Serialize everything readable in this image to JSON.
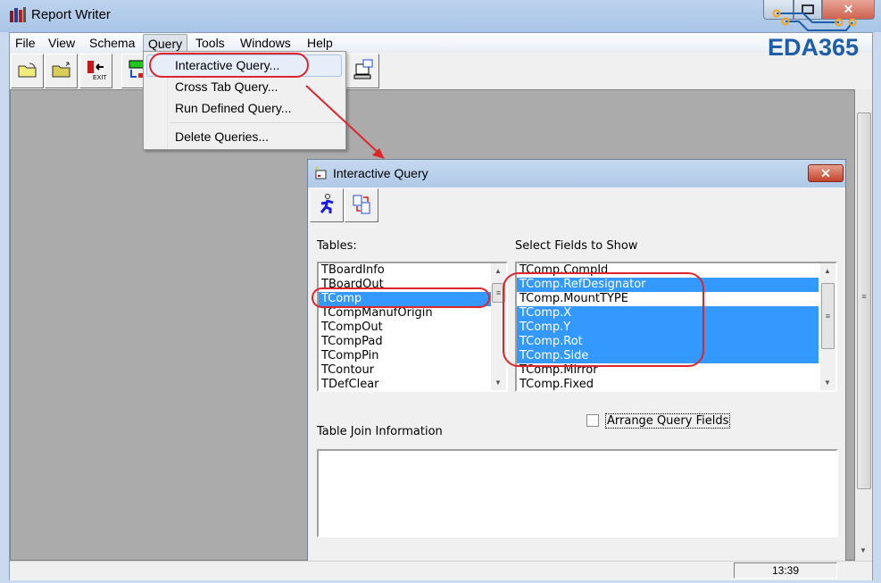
{
  "app": {
    "title": "Report Writer",
    "logo": "EDA365"
  },
  "menu": [
    "File",
    "View",
    "Schema",
    "Query",
    "Tools",
    "Windows",
    "Help"
  ],
  "query_menu": {
    "items": [
      "Interactive Query...",
      "Cross Tab Query...",
      "Run Defined Query...",
      "Delete Queries..."
    ],
    "highlighted": "Interactive Query..."
  },
  "toolbar": {
    "icons": [
      "open-folder-icon",
      "folder-up-icon",
      "exit-icon",
      "schema-icon",
      "computer-icon"
    ]
  },
  "dialog": {
    "title": "Interactive Query",
    "close_label": "✕",
    "tables_label": "Tables:",
    "tables": [
      "TBoardInfo",
      "TBoardOut",
      "TComp",
      "TCompManufOrigin",
      "TCompOut",
      "TCompPad",
      "TCompPin",
      "TContour",
      "TDefClear"
    ],
    "tables_selected": [
      "TComp"
    ],
    "fields_label": "Select Fields to Show",
    "fields": [
      "TComp.CompId",
      "TComp.RefDesignator",
      "TComp.MountTYPE",
      "TComp.X",
      "TComp.Y",
      "TComp.Rot",
      "TComp.Side",
      "TComp.Mirror",
      "TComp.Fixed"
    ],
    "fields_selected": [
      "TComp.RefDesignator",
      "TComp.X",
      "TComp.Y",
      "TComp.Rot",
      "TComp.Side"
    ],
    "arrange_label": "Arrange Query Fields",
    "arrange_checked": false,
    "join_label": "Table Join Information",
    "join_value": ""
  },
  "status": {
    "clock": "13:39"
  },
  "colors": {
    "selection": "#3399ff",
    "annotation": "#e0242b",
    "logo": "#1e5ea8"
  }
}
